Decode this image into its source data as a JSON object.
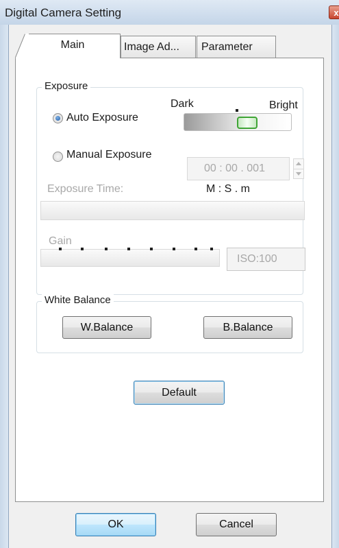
{
  "window": {
    "title": "Digital Camera Setting",
    "close_glyph": "x"
  },
  "tabs": [
    {
      "label": "Main",
      "active": true
    },
    {
      "label": "Image Ad...",
      "active": false
    },
    {
      "label": "Parameter",
      "active": false
    }
  ],
  "exposure": {
    "group_label": "Exposure",
    "auto_label": "Auto Exposure",
    "manual_label": "Manual Exposure",
    "selected": "auto",
    "brightness_min_label": "Dark",
    "brightness_max_label": "Bright",
    "brightness_level": 0.5,
    "time_value": "00 : 00 . 001",
    "time_format": "M : S . m",
    "exposure_time_label": "Exposure Time:",
    "gain_label": "Gain",
    "iso_value": "ISO:100"
  },
  "white_balance": {
    "group_label": "White Balance",
    "w_balance_label": "W.Balance",
    "b_balance_label": "B.Balance"
  },
  "default_label": "Default",
  "ok_label": "OK",
  "cancel_label": "Cancel",
  "colors": {
    "slider_thumb": "#3fa535",
    "focus_blue": "#3c7fb1",
    "close_red": "#c8452f"
  }
}
